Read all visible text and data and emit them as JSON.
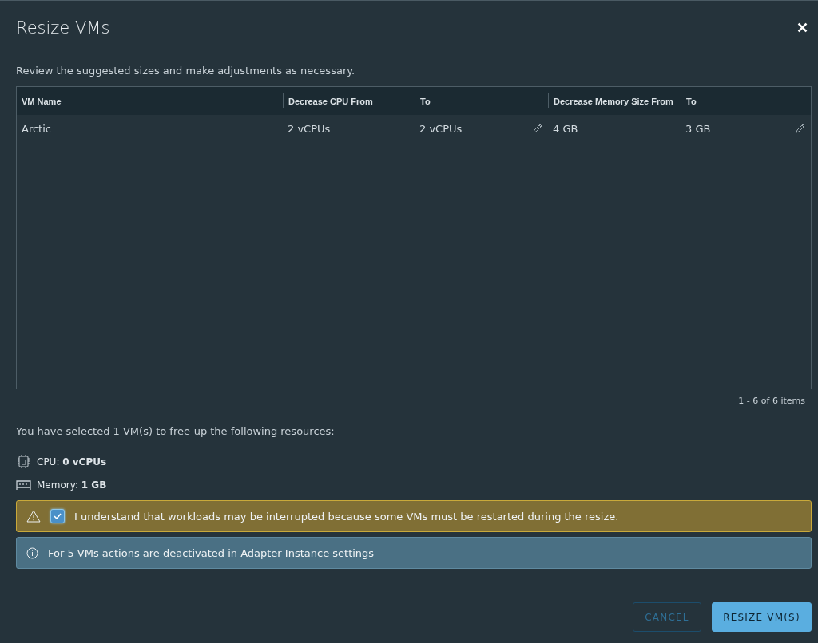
{
  "dialog": {
    "title": "Resize VMs",
    "close": "✕",
    "intro": "Review the suggested sizes and make adjustments as necessary."
  },
  "table": {
    "columns": [
      {
        "label": "VM Name",
        "kind": "text"
      },
      {
        "label": "Decrease CPU From",
        "kind": "text"
      },
      {
        "label": "To",
        "kind": "editable"
      },
      {
        "label": "Decrease Memory Size From",
        "kind": "text"
      },
      {
        "label": "To",
        "kind": "editable"
      }
    ],
    "rows": [
      [
        "Arctic",
        "2 vCPUs",
        "2 vCPUs",
        "4 GB",
        "3 GB"
      ]
    ],
    "footer": "1 - 6 of 6 items"
  },
  "summary": {
    "text": "You have selected 1 VM(s) to free-up the following resources:",
    "resources": [
      {
        "kind": "cpu",
        "text": "CPU: **0 vCPUs**"
      },
      {
        "kind": "memory",
        "text": "Memory: **1 GB**"
      }
    ]
  },
  "alerts": [
    {
      "kind": "warning",
      "checked": true,
      "text": "I understand that workloads may be interrupted because some VMs must be restarted during the resize."
    },
    {
      "kind": "info",
      "text": "For 5 VMs actions are deactivated in Adapter Instance settings"
    }
  ],
  "buttons": [
    {
      "label": "CANCEL",
      "kind": "outline"
    },
    {
      "label": "RESIZE VM(S)",
      "kind": "primary"
    }
  ]
}
